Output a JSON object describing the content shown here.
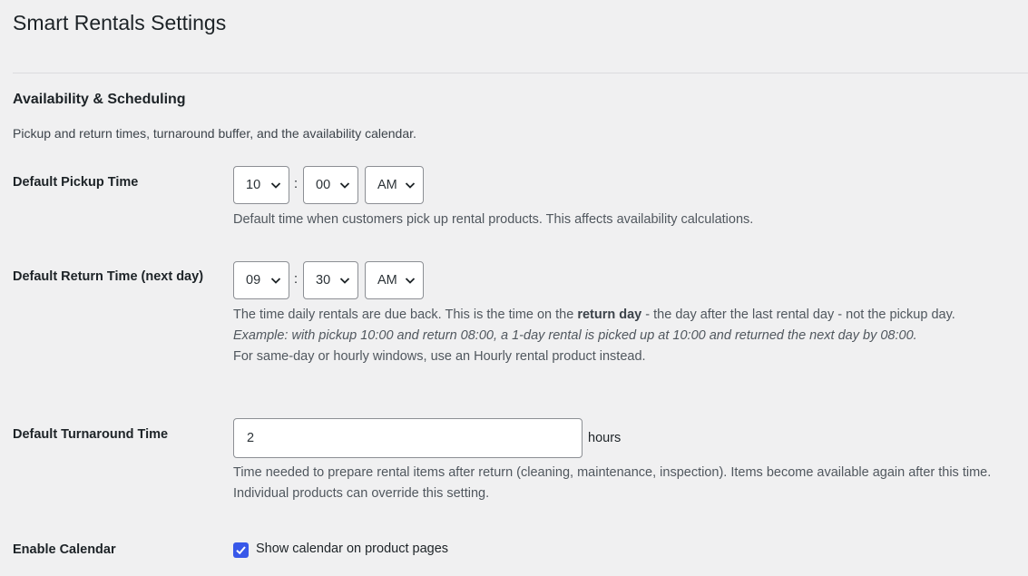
{
  "page": {
    "title": "Smart Rentals Settings"
  },
  "section": {
    "title": "Availability & Scheduling",
    "description": "Pickup and return times, turnaround buffer, and the availability calendar."
  },
  "pickup": {
    "label": "Default Pickup Time",
    "hour": "10",
    "minute": "00",
    "ampm": "AM",
    "separator": ":",
    "help": "Default time when customers pick up rental products. This affects availability calculations."
  },
  "return_time": {
    "label": "Default Return Time (next day)",
    "hour": "09",
    "minute": "30",
    "ampm": "AM",
    "separator": ":",
    "help_pre": "The time daily rentals are due back. This is the time on the ",
    "help_bold": "return day",
    "help_post": " - the day after the last rental day - not the pickup day.",
    "help_example": "Example: with pickup 10:00 and return 08:00, a 1-day rental is picked up at 10:00 and returned the next day by 08:00.",
    "help_note": "For same-day or hourly windows, use an Hourly rental product instead."
  },
  "turnaround": {
    "label": "Default Turnaround Time",
    "value": "2",
    "suffix": "hours",
    "help": "Time needed to prepare rental items after return (cleaning, maintenance, inspection). Items become available again after this time. Individual products can override this setting."
  },
  "calendar": {
    "label": "Enable Calendar",
    "checkbox_label": "Show calendar on product pages",
    "checked": true
  },
  "colors": {
    "background": "#f0f0f1",
    "accent": "#3858e9",
    "text": "#1d2327",
    "help_text": "#50575e"
  }
}
